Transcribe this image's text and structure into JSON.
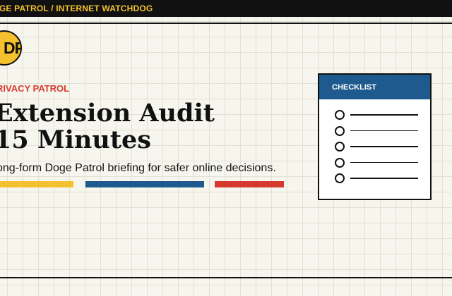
{
  "topbar": {
    "text": "DGE PATROL / INTERNET WATCHDOG"
  },
  "logo": {
    "text": "DP"
  },
  "article": {
    "kicker": "RIVACY PATROL",
    "headline_line1": "Extension Audit",
    "headline_line2": "15 Minutes",
    "subtitle": "ong-form Doge Patrol briefing for safer online decisions."
  },
  "checklist": {
    "title": "CHECKLIST",
    "item_count": 5
  },
  "colors": {
    "background": "#f7f6ee",
    "grid": "#e2e1d5",
    "bar": "#111111",
    "brand_yellow": "#f2c230",
    "logo_yellow": "#f5c12e",
    "accent_red": "#d63a2f",
    "accent_blue": "#1e5a8e",
    "stripe_yellow": "#f5c12e",
    "stripe_blue": "#1e5a8e",
    "stripe_red": "#d63a2f"
  }
}
